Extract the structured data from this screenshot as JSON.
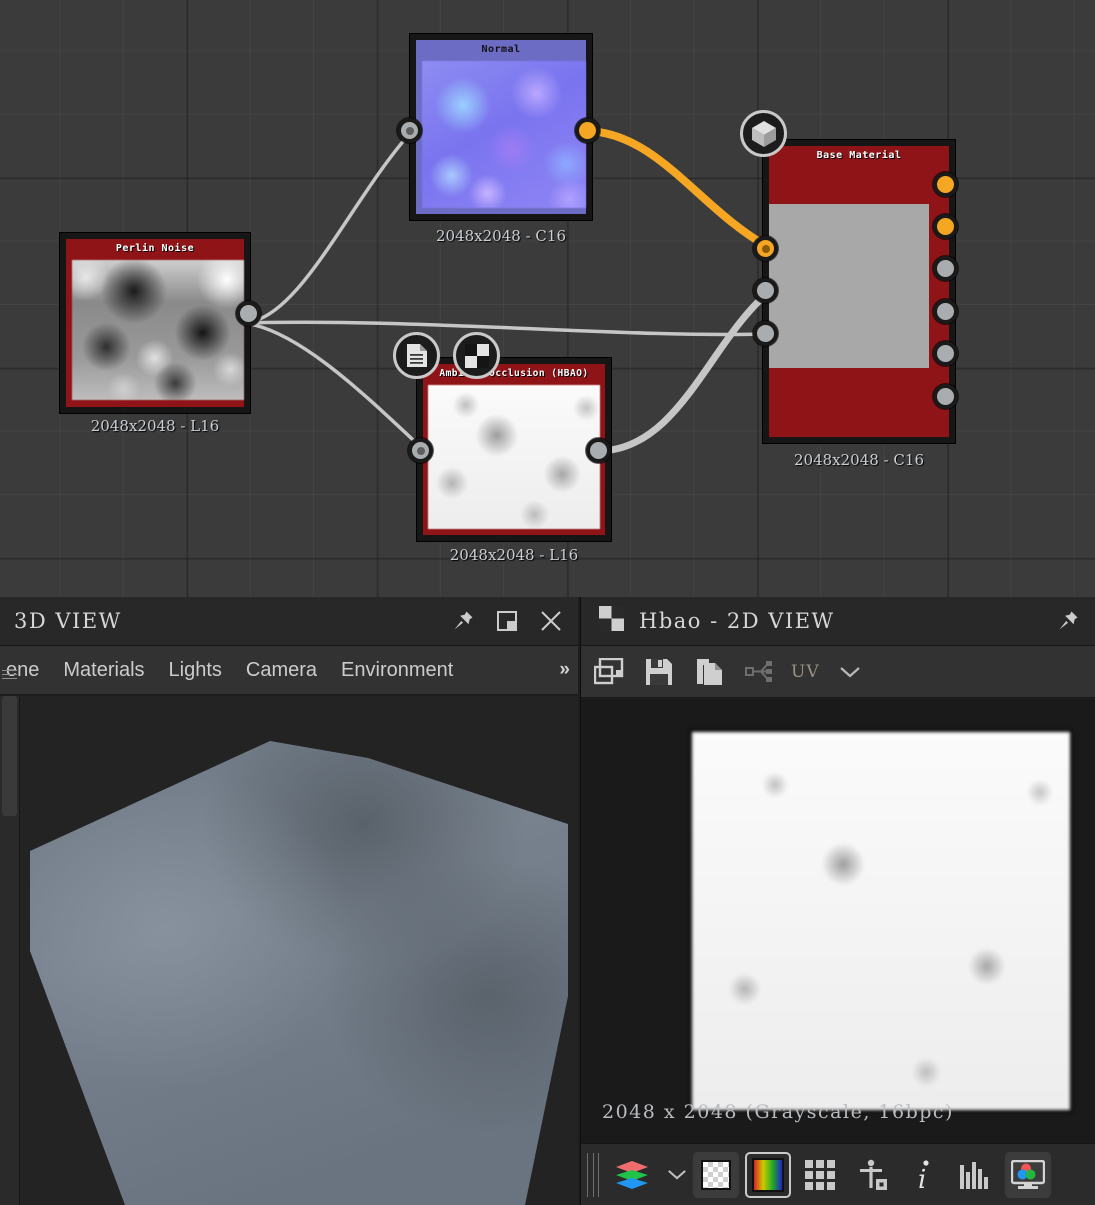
{
  "graph": {
    "nodes": [
      {
        "id": "perlin",
        "title": "Perlin Noise",
        "subtitle": "2048x2048 - L16"
      },
      {
        "id": "normal",
        "title": "Normal",
        "subtitle": "2048x2048 - C16"
      },
      {
        "id": "hbao",
        "title": "Ambient Occlusion (HBAO)",
        "subtitle": "2048x2048 - L16"
      },
      {
        "id": "base",
        "title": "Base Material",
        "subtitle": "2048x2048 - C16"
      }
    ],
    "colors": {
      "node_header_red": "#8f1417",
      "node_header_normal": "#6d6cc4",
      "socket_active": "#f5a623",
      "socket_idle": "#aaadb0",
      "wire_active": "#f5a623",
      "wire_idle": "#c6c6c6",
      "canvas": "#3b3b3b"
    },
    "badges": [
      {
        "name": "document-badge",
        "icon": "document-icon"
      },
      {
        "name": "checker-badge",
        "icon": "checkerboard-icon"
      },
      {
        "name": "cube-badge",
        "icon": "cube-icon"
      }
    ]
  },
  "view3d": {
    "title": "3D VIEW",
    "menu": [
      "ene",
      "Materials",
      "Lights",
      "Camera",
      "Environment"
    ],
    "overflow_label": "»",
    "title_buttons": [
      "pin-icon",
      "restore-icon",
      "close-icon"
    ]
  },
  "view2d": {
    "title": "Hbao - 2D VIEW",
    "title_buttons": [
      "pin-icon"
    ],
    "toolbar": {
      "items": [
        "duplicate-view-icon",
        "save-icon",
        "copy-icon",
        "graph-link-icon"
      ],
      "uv_label": "UV"
    },
    "resolution": "2048 x 2048 (Grayscale, 16bpc)",
    "bottom_icons": [
      "layers-icon",
      "chevron-down-icon",
      "transparency-icon",
      "color-channels-icon",
      "tiling-icon",
      "scale-reference-icon",
      "info-icon",
      "histogram-icon",
      "color-picker-icon"
    ]
  }
}
